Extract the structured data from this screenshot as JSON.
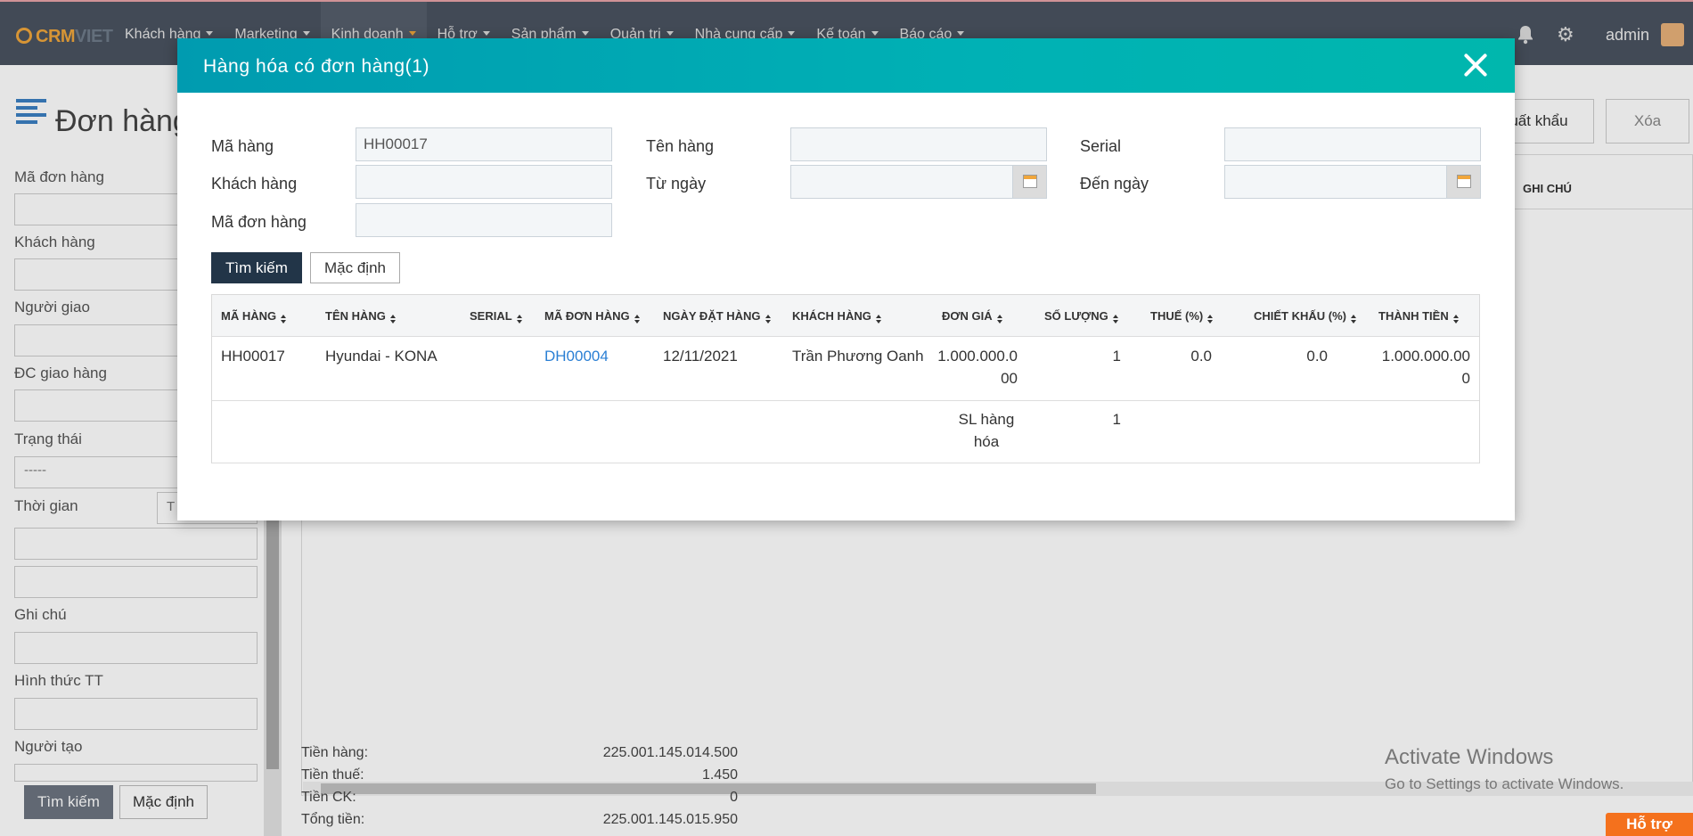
{
  "topnav": {
    "logo_text": "CRM",
    "logo_text2": "VIET",
    "menu": [
      {
        "label": "Khách hàng"
      },
      {
        "label": "Marketing"
      },
      {
        "label": "Kinh doanh"
      },
      {
        "label": "Hỗ trợ"
      },
      {
        "label": "Sản phẩm"
      },
      {
        "label": "Quản trị"
      },
      {
        "label": "Nhà cung cấp"
      },
      {
        "label": "Kế toán"
      },
      {
        "label": "Báo cáo"
      }
    ],
    "user": "admin"
  },
  "page": {
    "title": "Đơn hàng",
    "export_label": "Xuất khẩu",
    "delete_label": "Xóa",
    "grid_header_note": "GHI CHÚ",
    "sidebar": {
      "labels": [
        "Mã đơn hàng",
        "Khách hàng",
        "Người giao",
        "ĐC giao hàng",
        "Trạng thái",
        "Thời gian",
        "Ghi chú",
        "Hình thức TT",
        "Người tạo"
      ],
      "status_value": "-----",
      "time_value": "T",
      "search_label": "Tìm kiếm",
      "default_label": "Mặc định"
    },
    "totals": {
      "labels": [
        "Tiền hàng:",
        "Tiền thuế:",
        "Tiền CK:",
        "Tổng tiền:"
      ],
      "values": [
        "225.001.145.014.500",
        "1.450",
        "0",
        "225.001.145.015.950"
      ]
    },
    "activate_title": "Activate Windows",
    "activate_sub": "Go to Settings to activate Windows.",
    "support_label": "Hỗ trợ"
  },
  "modal": {
    "title": "Hàng hóa có đơn hàng(1)",
    "filters": {
      "ma_hang_label": "Mã hàng",
      "ma_hang_value": "HH00017",
      "ten_hang_label": "Tên hàng",
      "serial_label": "Serial",
      "khach_hang_label": "Khách hàng",
      "tu_ngay_label": "Từ ngày",
      "den_ngay_label": "Đến ngày",
      "ma_don_hang_label": "Mã đơn hàng"
    },
    "search_label": "Tìm kiếm",
    "default_label": "Mặc định",
    "table": {
      "headers": [
        "MÃ HÀNG",
        "TÊN HÀNG",
        "SERIAL",
        "MÃ ĐƠN HÀNG",
        "NGÀY ĐẶT HÀNG",
        "KHÁCH HÀNG",
        "ĐƠN GIÁ",
        "SỐ LƯỢNG",
        "THUẾ (%)",
        "CHIẾT KHẤU (%)",
        "THÀNH TIỀN"
      ],
      "row": {
        "ma_hang": "HH00017",
        "ten_hang": "Hyundai - KONA",
        "serial": "",
        "ma_don_hang": "DH00004",
        "ngay_dat": "12/11/2021",
        "khach_hang": "Trần Phương Oanh",
        "don_gia_l1": "1.000.000.0",
        "don_gia_l2": "00",
        "so_luong": "1",
        "thue": "0.0",
        "chiet_khau": "0.0",
        "thanh_tien_l1": "1.000.000.00",
        "thanh_tien_l2": "0"
      },
      "summary_label_l1": "SL hàng",
      "summary_label_l2": "hóa",
      "summary_value": "1"
    }
  }
}
